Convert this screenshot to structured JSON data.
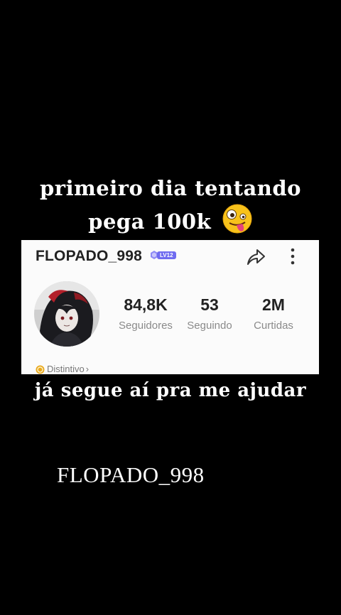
{
  "caption": {
    "line1": "primeiro dia tentando",
    "line2": "pega 100k",
    "line2_emoji": "zany-face-emoji",
    "bottom": "já segue aí pra me ajudar",
    "handle": "FLOPADO_998"
  },
  "profile": {
    "username": "FLOPADO_998",
    "level": "LV12",
    "stats": {
      "followers": {
        "value": "84,8K",
        "label": "Seguidores"
      },
      "following": {
        "value": "53",
        "label": "Seguindo"
      },
      "likes": {
        "value": "2M",
        "label": "Curtidas"
      }
    },
    "badge_link": "Distintivo",
    "badge_chevron": "›"
  },
  "icons": {
    "share": "share-arrow-icon",
    "more": "vertical-dots-icon",
    "level_gem": "level-gem-icon",
    "coin": "badge-coin-icon"
  },
  "colors": {
    "background": "#000000",
    "card": "#fbfbfb",
    "level_badge": "#6f6bf0",
    "coin": "#e8a81e"
  }
}
